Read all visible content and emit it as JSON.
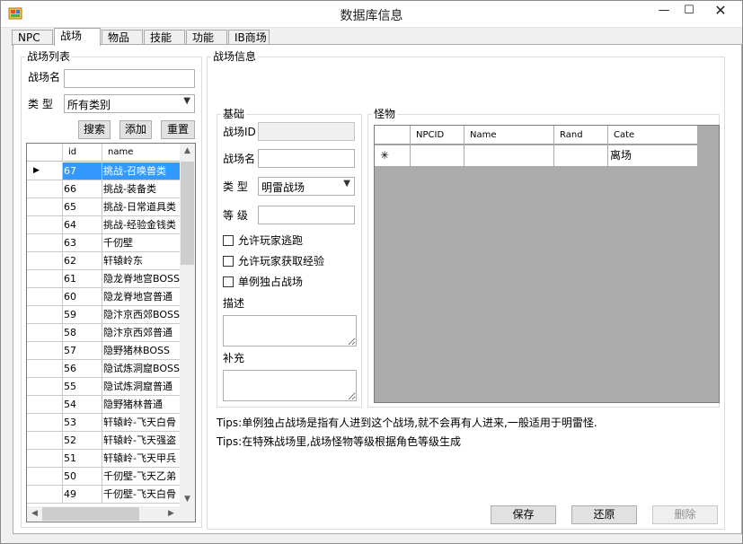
{
  "window": {
    "title": "数据库信息",
    "min_glyph": "—",
    "max_glyph": "☐",
    "close_glyph": "✕"
  },
  "tabs": [
    "NPC",
    "战场",
    "物品",
    "技能",
    "功能",
    "IB商场"
  ],
  "active_tab": "战场",
  "battle_list": {
    "legend": "战场列表",
    "name_label": "战场名",
    "name_value": "",
    "type_label": "类 型",
    "type_value": "所有类别",
    "search_button": "搜索",
    "add_button": "添加",
    "reset_button": "重置",
    "columns": [
      "id",
      "name"
    ],
    "rows": [
      {
        "id": "67",
        "name": "挑战-召唤兽类"
      },
      {
        "id": "66",
        "name": "挑战-装备类"
      },
      {
        "id": "65",
        "name": "挑战-日常道具类"
      },
      {
        "id": "64",
        "name": "挑战-经验金钱类"
      },
      {
        "id": "63",
        "name": "千仞壁"
      },
      {
        "id": "62",
        "name": "轩辕岭东"
      },
      {
        "id": "61",
        "name": "隐龙脊地宫BOSS"
      },
      {
        "id": "60",
        "name": "隐龙脊地宫普通"
      },
      {
        "id": "59",
        "name": "隐汴京西郊BOSS"
      },
      {
        "id": "58",
        "name": "隐汴京西郊普通"
      },
      {
        "id": "57",
        "name": "隐野猪林BOSS"
      },
      {
        "id": "56",
        "name": "隐试炼洞窟BOSS"
      },
      {
        "id": "55",
        "name": "隐试炼洞窟普通"
      },
      {
        "id": "54",
        "name": "隐野猪林普通"
      },
      {
        "id": "53",
        "name": "轩辕岭-飞天白骨"
      },
      {
        "id": "52",
        "name": "轩辕岭-飞天强盗"
      },
      {
        "id": "51",
        "name": "轩辕岭-飞天甲兵"
      },
      {
        "id": "50",
        "name": "千仞壁-飞天乙弟"
      },
      {
        "id": "49",
        "name": "千仞壁-飞天白骨"
      }
    ],
    "selected_index": 0
  },
  "battle_info": {
    "legend": "战场信息",
    "basic_legend": "基础",
    "id_label": "战场ID",
    "id_value": "",
    "name_label": "战场名",
    "name_value": "",
    "type_label": "类 型",
    "type_value": "明雷战场",
    "level_label": "等 级",
    "level_value": "",
    "allow_escape": "允许玩家逃跑",
    "allow_exp": "允许玩家获取经验",
    "exclusive": "单例独占战场",
    "desc_label": "描述",
    "supplement_label": "补充",
    "monster_legend": "怪物",
    "monster_columns": [
      "NPCID",
      "Name",
      "Rand",
      "Cate"
    ],
    "new_row_marker": "✳",
    "new_row_cate": "离场",
    "tips": [
      "Tips:单例独占战场是指有人进到这个战场,就不会再有人进来,一般适用于明雷怪.",
      "Tips:在特殊战场里,战场怪物等级根据角色等级生成"
    ],
    "save_button": "保存",
    "restore_button": "还原",
    "delete_button": "删除"
  }
}
